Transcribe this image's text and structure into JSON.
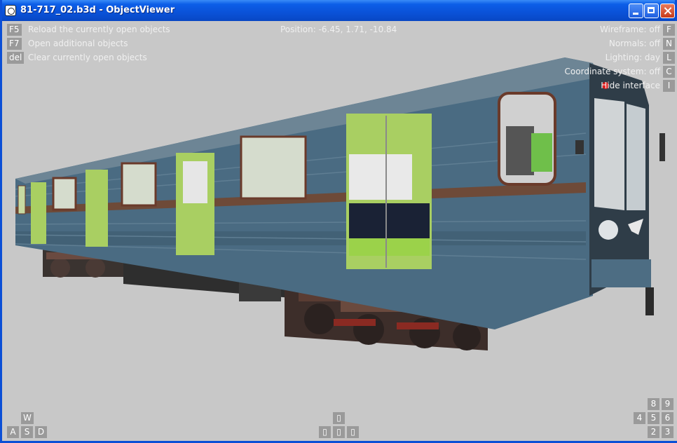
{
  "window": {
    "title": "81-717_02.b3d - ObjectViewer"
  },
  "hud": {
    "left": [
      {
        "key": "F5",
        "label": "Reload the currently open objects"
      },
      {
        "key": "F7",
        "label": "Open additional objects"
      },
      {
        "key": "del",
        "label": "Clear currently open objects"
      }
    ],
    "position": "Position: -6.45, 1.71, -10.84",
    "right": [
      {
        "key": "F",
        "label": "Wireframe: off"
      },
      {
        "key": "N",
        "label": "Normals: off"
      },
      {
        "key": "L",
        "label": "Lighting: day"
      },
      {
        "key": "C",
        "label": "Coordinate system: off"
      },
      {
        "key": "I",
        "label": "Hide interface"
      }
    ],
    "move_keys": {
      "w": "W",
      "a": "A",
      "s": "S",
      "d": "D"
    },
    "arrow_keys": {
      "up": "▯",
      "left": "▯",
      "down": "▯",
      "right": "▯"
    },
    "numpad": {
      "n8": "8",
      "n9": "9",
      "n4": "4",
      "n5": "5",
      "n6": "6",
      "n2": "2",
      "n3": "3"
    }
  },
  "colors": {
    "viewport_bg": "#c8c8c8",
    "key_bg": "#9a9a9a",
    "car_body": "#4a6b82",
    "car_interior": "#a9cf62"
  }
}
